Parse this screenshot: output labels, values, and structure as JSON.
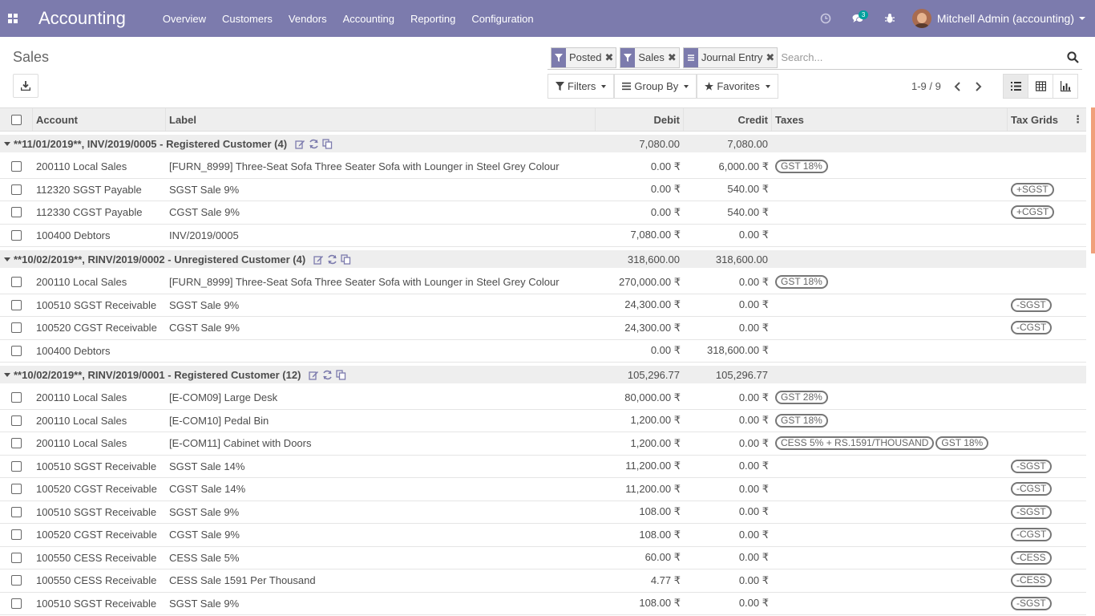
{
  "navbar": {
    "app_title": "Accounting",
    "menu": [
      "Overview",
      "Customers",
      "Vendors",
      "Accounting",
      "Reporting",
      "Configuration"
    ],
    "chat_badge": "3",
    "user_name": "Mitchell Admin (accounting)",
    "bar_color": "#7c7bad"
  },
  "breadcrumb": "Sales",
  "search": {
    "facets": [
      {
        "icon": "filter-icon",
        "label": "Posted"
      },
      {
        "icon": "filter-icon",
        "label": "Sales"
      },
      {
        "icon": "group-icon",
        "label": "Journal Entry"
      }
    ],
    "placeholder": "Search..."
  },
  "controls": {
    "filters": "Filters",
    "group_by": "Group By",
    "favorites": "Favorites",
    "pager": "1-9 / 9"
  },
  "table": {
    "headers": {
      "account": "Account",
      "label": "Label",
      "debit": "Debit",
      "credit": "Credit",
      "taxes": "Taxes",
      "tax_grids": "Tax Grids"
    },
    "groups": [
      {
        "title": "**11/01/2019**, INV/2019/0005 - Registered Customer (4)",
        "debit": "7,080.00",
        "credit": "7,080.00",
        "rows": [
          {
            "account": "200110 Local Sales",
            "label": "[FURN_8999] Three-Seat Sofa Three Seater Sofa with Lounger in Steel Grey Colour",
            "debit": "0.00 ₹",
            "credit": "6,000.00 ₹",
            "taxes": [
              "GST 18%"
            ],
            "grids": []
          },
          {
            "account": "112320 SGST Payable",
            "label": "SGST Sale 9%",
            "debit": "0.00 ₹",
            "credit": "540.00 ₹",
            "taxes": [],
            "grids": [
              "+SGST"
            ]
          },
          {
            "account": "112330 CGST Payable",
            "label": "CGST Sale 9%",
            "debit": "0.00 ₹",
            "credit": "540.00 ₹",
            "taxes": [],
            "grids": [
              "+CGST"
            ]
          },
          {
            "account": "100400 Debtors",
            "label": "INV/2019/0005",
            "debit": "7,080.00 ₹",
            "credit": "0.00 ₹",
            "taxes": [],
            "grids": []
          }
        ]
      },
      {
        "title": "**10/02/2019**, RINV/2019/0002 - Unregistered Customer (4)",
        "debit": "318,600.00",
        "credit": "318,600.00",
        "rows": [
          {
            "account": "200110 Local Sales",
            "label": "[FURN_8999] Three-Seat Sofa Three Seater Sofa with Lounger in Steel Grey Colour",
            "debit": "270,000.00 ₹",
            "credit": "0.00 ₹",
            "taxes": [
              "GST 18%"
            ],
            "grids": []
          },
          {
            "account": "100510 SGST Receivable",
            "label": "SGST Sale 9%",
            "debit": "24,300.00 ₹",
            "credit": "0.00 ₹",
            "taxes": [],
            "grids": [
              "-SGST"
            ]
          },
          {
            "account": "100520 CGST Receivable",
            "label": "CGST Sale 9%",
            "debit": "24,300.00 ₹",
            "credit": "0.00 ₹",
            "taxes": [],
            "grids": [
              "-CGST"
            ]
          },
          {
            "account": "100400 Debtors",
            "label": "",
            "debit": "0.00 ₹",
            "credit": "318,600.00 ₹",
            "taxes": [],
            "grids": []
          }
        ]
      },
      {
        "title": "**10/02/2019**, RINV/2019/0001 - Registered Customer (12)",
        "debit": "105,296.77",
        "credit": "105,296.77",
        "rows": [
          {
            "account": "200110 Local Sales",
            "label": "[E-COM09] Large Desk",
            "debit": "80,000.00 ₹",
            "credit": "0.00 ₹",
            "taxes": [
              "GST 28%"
            ],
            "grids": []
          },
          {
            "account": "200110 Local Sales",
            "label": "[E-COM10] Pedal Bin",
            "debit": "1,200.00 ₹",
            "credit": "0.00 ₹",
            "taxes": [
              "GST 18%"
            ],
            "grids": []
          },
          {
            "account": "200110 Local Sales",
            "label": "[E-COM11] Cabinet with Doors",
            "debit": "1,200.00 ₹",
            "credit": "0.00 ₹",
            "taxes": [
              "CESS 5% + RS.1591/THOUSAND",
              "GST 18%"
            ],
            "grids": []
          },
          {
            "account": "100510 SGST Receivable",
            "label": "SGST Sale 14%",
            "debit": "11,200.00 ₹",
            "credit": "0.00 ₹",
            "taxes": [],
            "grids": [
              "-SGST"
            ]
          },
          {
            "account": "100520 CGST Receivable",
            "label": "CGST Sale 14%",
            "debit": "11,200.00 ₹",
            "credit": "0.00 ₹",
            "taxes": [],
            "grids": [
              "-CGST"
            ]
          },
          {
            "account": "100510 SGST Receivable",
            "label": "SGST Sale 9%",
            "debit": "108.00 ₹",
            "credit": "0.00 ₹",
            "taxes": [],
            "grids": [
              "-SGST"
            ]
          },
          {
            "account": "100520 CGST Receivable",
            "label": "CGST Sale 9%",
            "debit": "108.00 ₹",
            "credit": "0.00 ₹",
            "taxes": [],
            "grids": [
              "-CGST"
            ]
          },
          {
            "account": "100550 CESS Receivable",
            "label": "CESS Sale 5%",
            "debit": "60.00 ₹",
            "credit": "0.00 ₹",
            "taxes": [],
            "grids": [
              "-CESS"
            ]
          },
          {
            "account": "100550 CESS Receivable",
            "label": "CESS Sale 1591 Per Thousand",
            "debit": "4.77 ₹",
            "credit": "0.00 ₹",
            "taxes": [],
            "grids": [
              "-CESS"
            ]
          },
          {
            "account": "100510 SGST Receivable",
            "label": "SGST Sale 9%",
            "debit": "108.00 ₹",
            "credit": "0.00 ₹",
            "taxes": [],
            "grids": [
              "-SGST"
            ]
          }
        ]
      }
    ]
  }
}
